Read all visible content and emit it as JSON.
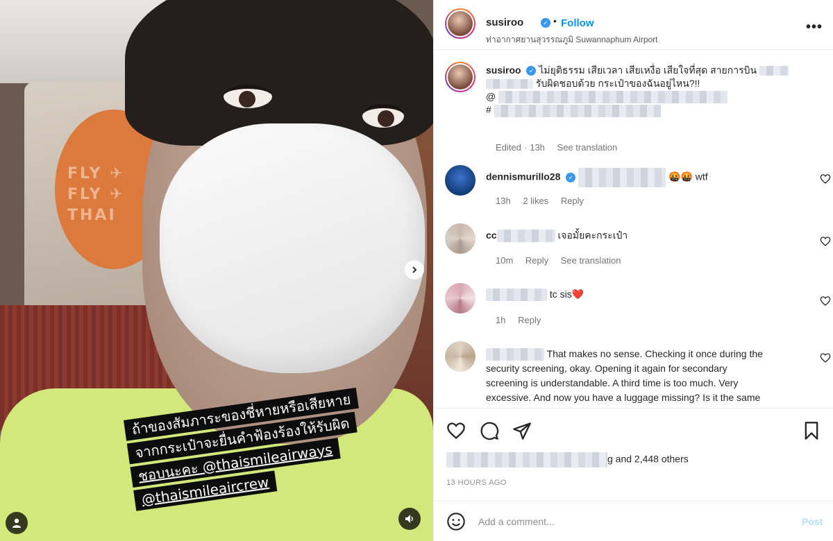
{
  "post": {
    "username": "susiroo",
    "follow_label": "Follow",
    "location": "ท่าอากาศยานสุวรรณภูมิ Suwannaphum Airport",
    "more_icon": "more-horizontal-icon"
  },
  "media": {
    "seat_text": "FLY ✈ FLY ✈ THAI",
    "overlay_lines": [
      "ถ้าของสัมภาระของชี่หายหรือเสียหาย",
      "จากกระเป๋าจะยื่นคำฟ้องร้องให้รับผิด",
      "ชอบนะคะ @thaismileairways",
      "@thaismileaircrew"
    ]
  },
  "caption": {
    "username": "susiroo",
    "text_1": "ไม่ยุติธรรม เสียเวลา เสียเหงื่อ เสียใจที่สุด สายการบิน",
    "text_2": "รับผิดชอบด้วย กระเป๋าของฉันอยู่ไหน?!!",
    "line_3": "@",
    "line_4": "#",
    "edited": "Edited",
    "time": "13h",
    "see_translation": "See translation"
  },
  "comments": [
    {
      "username": "dennismurillo28",
      "text": "🤬🤬 wtf",
      "time": "13h",
      "likes": "2 likes",
      "reply": "Reply"
    },
    {
      "username": "cc",
      "text": "เจอมั้ยคะกระเป๋า",
      "time": "10m",
      "reply": "Reply",
      "see_translation": "See translation"
    },
    {
      "username": "",
      "text": "tc sis❤️",
      "time": "1h",
      "reply": "Reply"
    },
    {
      "username": "",
      "text_lines": [
        "That makes no sense. Checking it once during the",
        "security screening, okay. Opening it again for secondary",
        "screening is understandable. A third time is too much. Very",
        "excessive. And now you have a luggage missing? Is it the same"
      ]
    }
  ],
  "likes": {
    "suffix": "g and 2,448 others"
  },
  "timestamp": "13 HOURS AGO",
  "add_comment": {
    "placeholder": "Add a comment...",
    "post_label": "Post"
  },
  "colors": {
    "accent": "#0095f6",
    "verified": "#3897f0",
    "post_disabled": "#b2dffc",
    "heart": "#ed4956"
  }
}
